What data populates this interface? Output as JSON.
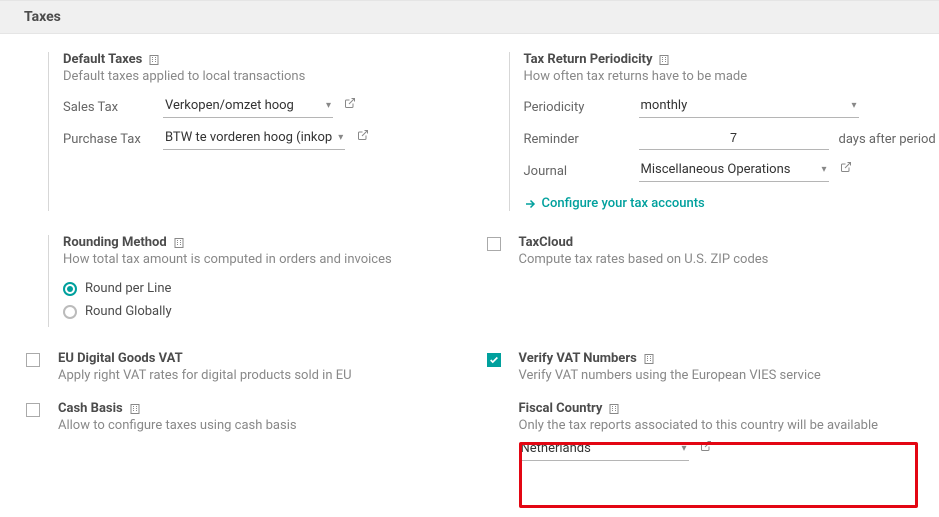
{
  "section": {
    "title": "Taxes"
  },
  "default_taxes": {
    "title": "Default Taxes",
    "desc": "Default taxes applied to local transactions",
    "sales_tax_label": "Sales Tax",
    "sales_tax_value": "Verkopen/omzet hoog",
    "purchase_tax_label": "Purchase Tax",
    "purchase_tax_value": "BTW te vorderen hoog (inkop"
  },
  "tax_return": {
    "title": "Tax Return Periodicity",
    "desc": "How often tax returns have to be made",
    "periodicity_label": "Periodicity",
    "periodicity_value": "monthly",
    "reminder_label": "Reminder",
    "reminder_value": "7",
    "reminder_suffix": "days after period",
    "journal_label": "Journal",
    "journal_value": "Miscellaneous Operations",
    "configure_link": "Configure your tax accounts"
  },
  "rounding": {
    "title": "Rounding Method",
    "desc": "How total tax amount is computed in orders and invoices",
    "option_line": "Round per Line",
    "option_global": "Round Globally"
  },
  "taxcloud": {
    "title": "TaxCloud",
    "desc": "Compute tax rates based on U.S. ZIP codes"
  },
  "eu_vat": {
    "title": "EU Digital Goods VAT",
    "desc": "Apply right VAT rates for digital products sold in EU"
  },
  "verify_vat": {
    "title": "Verify VAT Numbers",
    "desc": "Verify VAT numbers using the European VIES service"
  },
  "cash_basis": {
    "title": "Cash Basis",
    "desc": "Allow to configure taxes using cash basis"
  },
  "fiscal_country": {
    "title": "Fiscal Country",
    "desc": "Only the tax reports associated to this country will be available",
    "value": "Netherlands"
  }
}
